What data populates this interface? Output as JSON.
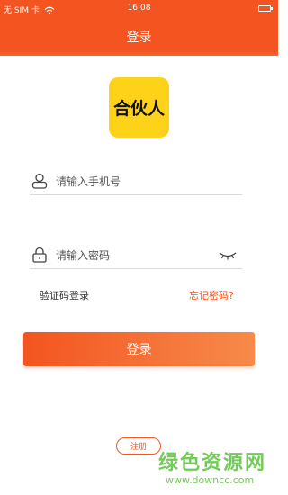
{
  "status_bar": {
    "carrier": "无 SIM 卡",
    "time": "16:08",
    "icons": [
      "wifi-icon",
      "battery-icon"
    ]
  },
  "header": {
    "title": "登录"
  },
  "logo": {
    "text": "合伙人"
  },
  "form": {
    "phone": {
      "placeholder": "请输入手机号",
      "value": "",
      "icon": "user-icon"
    },
    "password": {
      "placeholder": "请输入密码",
      "value": "",
      "icon": "lock-icon",
      "toggle_icon": "eye-closed-icon"
    }
  },
  "links": {
    "sms_login": "验证码登录",
    "forgot_password": "忘记密码?"
  },
  "buttons": {
    "login": "登录",
    "register": "注册"
  },
  "watermark": {
    "text": "绿色资源网",
    "url": "www.downcc.com"
  },
  "colors": {
    "accent": "#f4541f",
    "logo_bg": "#ffd21a",
    "watermark": "#5cc13b"
  }
}
